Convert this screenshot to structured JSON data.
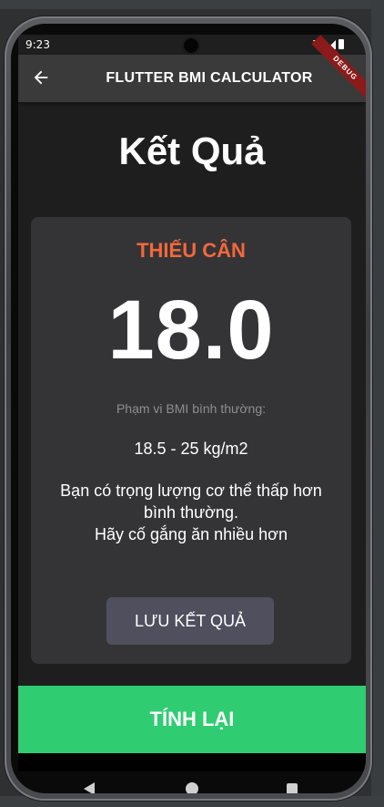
{
  "status_bar": {
    "time": "9:23"
  },
  "app_bar": {
    "title": "FLUTTER BMI CALCULATOR",
    "back_icon": "arrow-left-icon",
    "debug_banner": "DEBUG"
  },
  "page": {
    "title": "Kết Quả"
  },
  "result": {
    "status": "THIẾU CÂN",
    "status_color": "#f4683c",
    "bmi": "18.0",
    "range_caption": "Phạm vi BMI bình thường:",
    "range_value": "18.5 - 25 kg/m2",
    "advice_line1": "Bạn có trọng lượng cơ thể thấp hơn",
    "advice_line2": "bình thường.",
    "advice_line3": "Hãy cố gắng ăn nhiều hơn",
    "save_label": "LƯU KẾT QUẢ"
  },
  "actions": {
    "recalc_label": "TÍNH LẠI",
    "recalc_color": "#2fcc71"
  },
  "nav": {
    "back_icon": "nav-back-icon",
    "home_icon": "nav-home-icon",
    "recent_icon": "nav-recent-icon"
  }
}
